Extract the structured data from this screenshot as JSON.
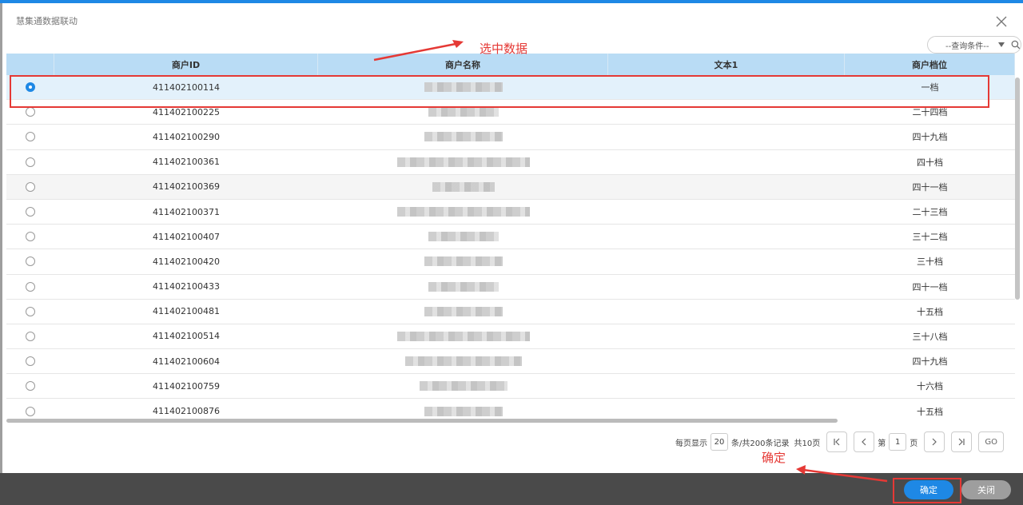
{
  "dialog": {
    "title": "慧集通数据联动"
  },
  "search": {
    "placeholder": "--查询条件--"
  },
  "table": {
    "headers": [
      "商户ID",
      "商户名称",
      "文本1",
      "商户档位"
    ],
    "rows": [
      {
        "id": "411402100114",
        "level": "一档",
        "selected": true
      },
      {
        "id": "411402100225",
        "level": "二十四档"
      },
      {
        "id": "411402100290",
        "level": "四十九档"
      },
      {
        "id": "411402100361",
        "level": "四十档"
      },
      {
        "id": "411402100369",
        "level": "四十一档"
      },
      {
        "id": "411402100371",
        "level": "二十三档"
      },
      {
        "id": "411402100407",
        "level": "三十二档"
      },
      {
        "id": "411402100420",
        "level": "三十档"
      },
      {
        "id": "411402100433",
        "level": "四十一档"
      },
      {
        "id": "411402100481",
        "level": "十五档"
      },
      {
        "id": "411402100514",
        "level": "三十八档"
      },
      {
        "id": "411402100604",
        "level": "四十九档"
      },
      {
        "id": "411402100759",
        "level": "十六档"
      },
      {
        "id": "411402100876",
        "level": "十五档"
      }
    ]
  },
  "pager": {
    "per_page_label": "每页显示",
    "per_page": "20",
    "total_label": "条/共200条记录",
    "pages_label": "共10页",
    "page_prefix": "第",
    "page": "1",
    "page_suffix": "页",
    "go_label": "GO"
  },
  "footer": {
    "ok_label": "确定",
    "close_label": "关闭"
  },
  "annotations": {
    "select_data": "选中数据",
    "confirm": "确定"
  },
  "colors": {
    "accent": "#1e88e5",
    "annotation": "#e53935",
    "header_bg": "#b9dcf5"
  }
}
